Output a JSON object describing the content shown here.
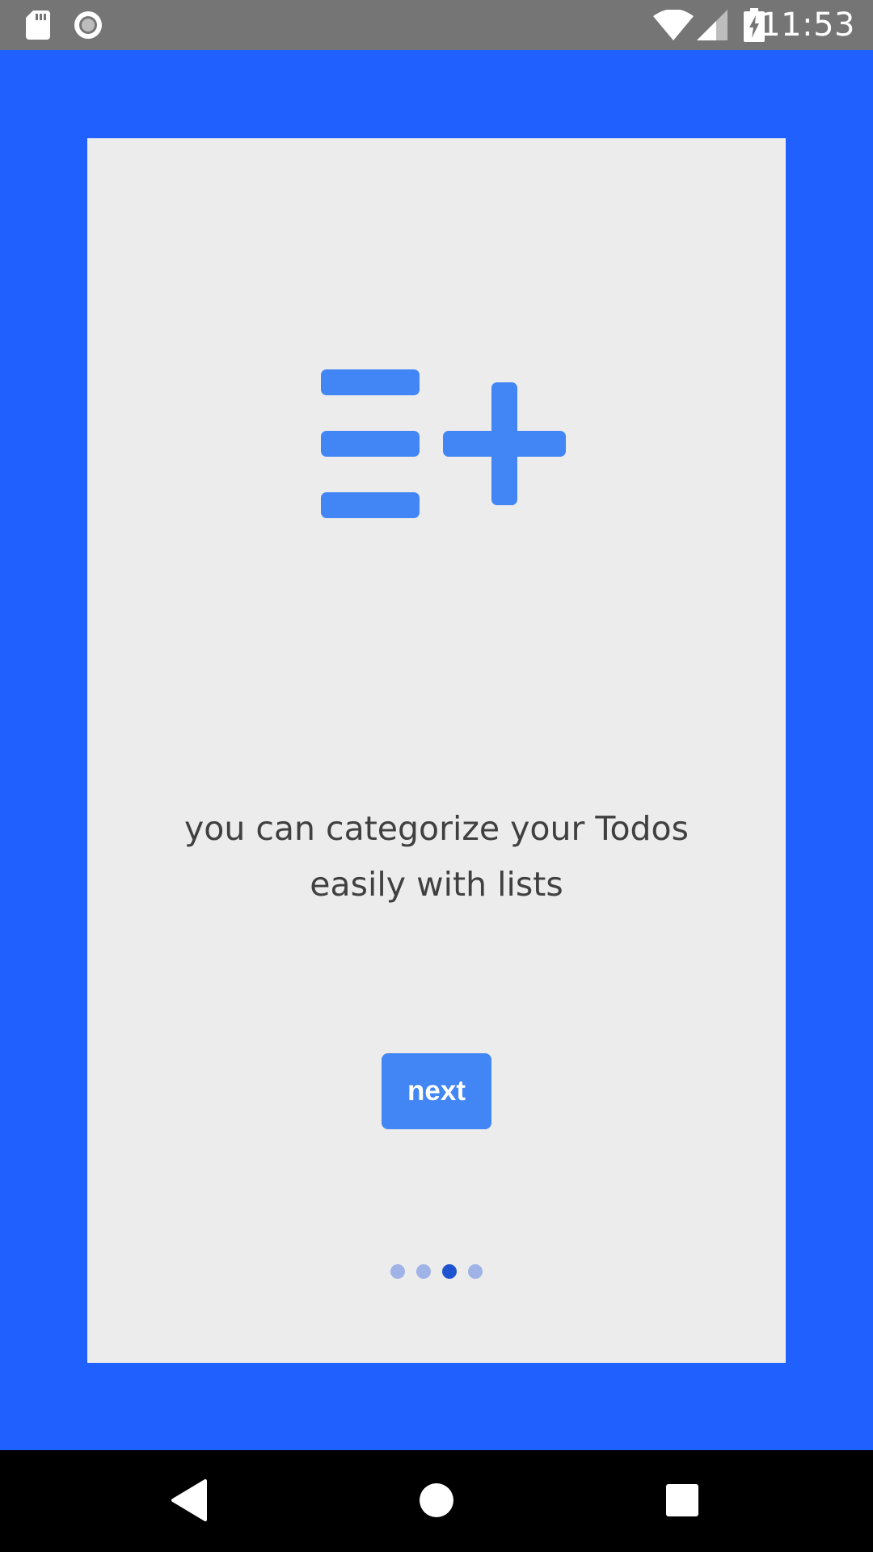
{
  "status_bar": {
    "time": "11:53",
    "icons": [
      "sd-card-icon",
      "sync-icon",
      "wifi-icon",
      "signal-icon",
      "battery-charging-icon"
    ]
  },
  "onboarding": {
    "icon": "playlist-add-icon",
    "headline_lines": [
      "you can categorize your Todos",
      "easily with lists"
    ],
    "next_label": "next",
    "page_count": 4,
    "current_page": 3
  },
  "nav_bar": {
    "icons": [
      "back-icon",
      "home-icon",
      "recents-icon"
    ]
  },
  "colors": {
    "background": "#2060ff",
    "card": "#ececed",
    "accent": "#4285f4",
    "text": "#404040",
    "dot_active": "#1f54d0",
    "dot_inactive": "#9fb3e6"
  }
}
